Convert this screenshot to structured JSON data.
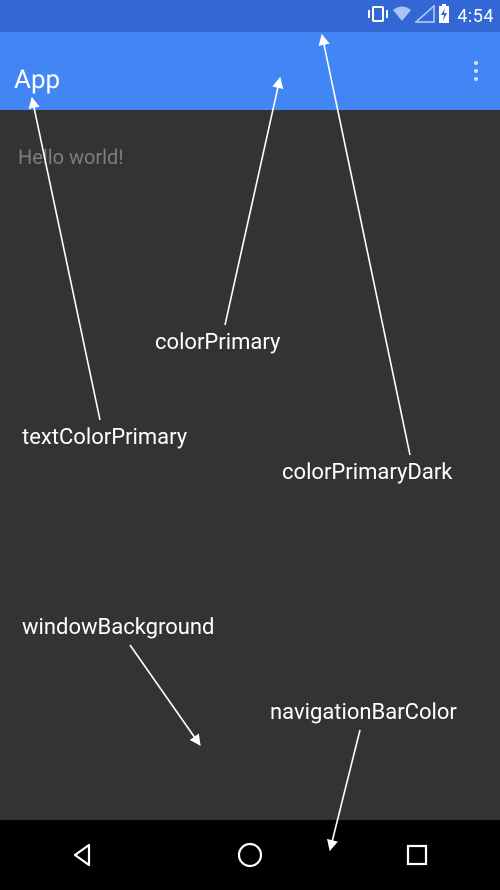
{
  "statusbar": {
    "time": "4:54"
  },
  "actionbar": {
    "title": "App"
  },
  "content": {
    "hello": "Hello world!"
  },
  "annotations": {
    "colorPrimary": "colorPrimary",
    "textColorPrimary": "textColorPrimary",
    "colorPrimaryDark": "colorPrimaryDark",
    "windowBackground": "windowBackground",
    "navigationBarColor": "navigationBarColor"
  },
  "colors": {
    "colorPrimaryDark": "#3367d6",
    "colorPrimary": "#4285f4",
    "windowBackground": "#333333",
    "navigationBarColor": "#000000",
    "textColorPrimary": "#ffffff"
  }
}
